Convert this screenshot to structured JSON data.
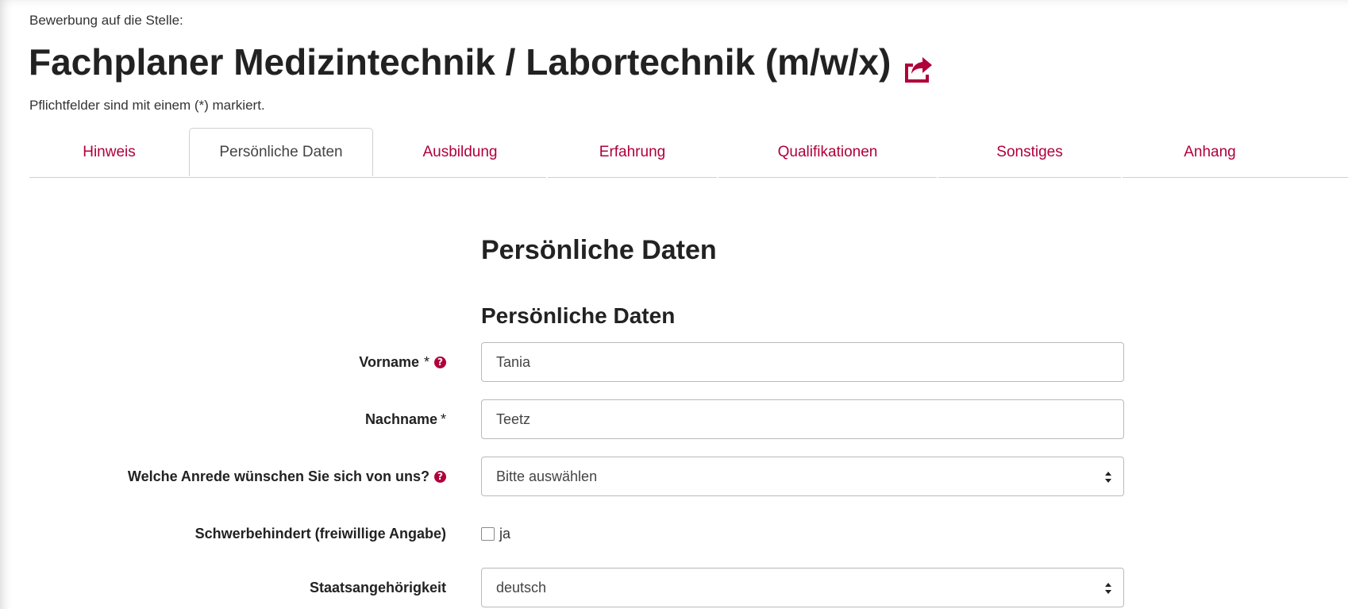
{
  "header": {
    "kicker": "Bewerbung auf die Stelle:",
    "title": "Fachplaner Medizintechnik / Labortechnik (m/w/x)",
    "share_icon": "share-square-icon",
    "required_hint": "Pflichtfelder sind mit einem (*) markiert."
  },
  "tabs": [
    {
      "label": "Hinweis",
      "active": false
    },
    {
      "label": "Persönliche Daten",
      "active": true
    },
    {
      "label": "Ausbildung",
      "active": false
    },
    {
      "label": "Erfahrung",
      "active": false
    },
    {
      "label": "Qualifikationen",
      "active": false
    },
    {
      "label": "Sonstiges",
      "active": false
    },
    {
      "label": "Anhang",
      "active": false
    }
  ],
  "form": {
    "section_title": "Persönliche Daten",
    "sub_title": "Persönliche Daten",
    "fields": {
      "vorname": {
        "label": "Vorname",
        "required": "*",
        "value": "Tania",
        "help_icon": "question-circle-icon"
      },
      "nachname": {
        "label": "Nachname",
        "required": "*",
        "value": "Teetz"
      },
      "anrede": {
        "label": "Welche Anrede wünschen Sie sich von uns?",
        "value": "Bitte auswählen",
        "help_icon": "question-circle-icon"
      },
      "schwerbehindert": {
        "label": "Schwerbehindert (freiwillige Angabe)",
        "option": "ja",
        "checked": false
      },
      "staatsangehoerigkeit": {
        "label": "Staatsangehörigkeit",
        "value": "deutsch"
      }
    }
  },
  "colors": {
    "accent": "#b0003a",
    "text": "#333333",
    "border": "#b9b9b9"
  }
}
